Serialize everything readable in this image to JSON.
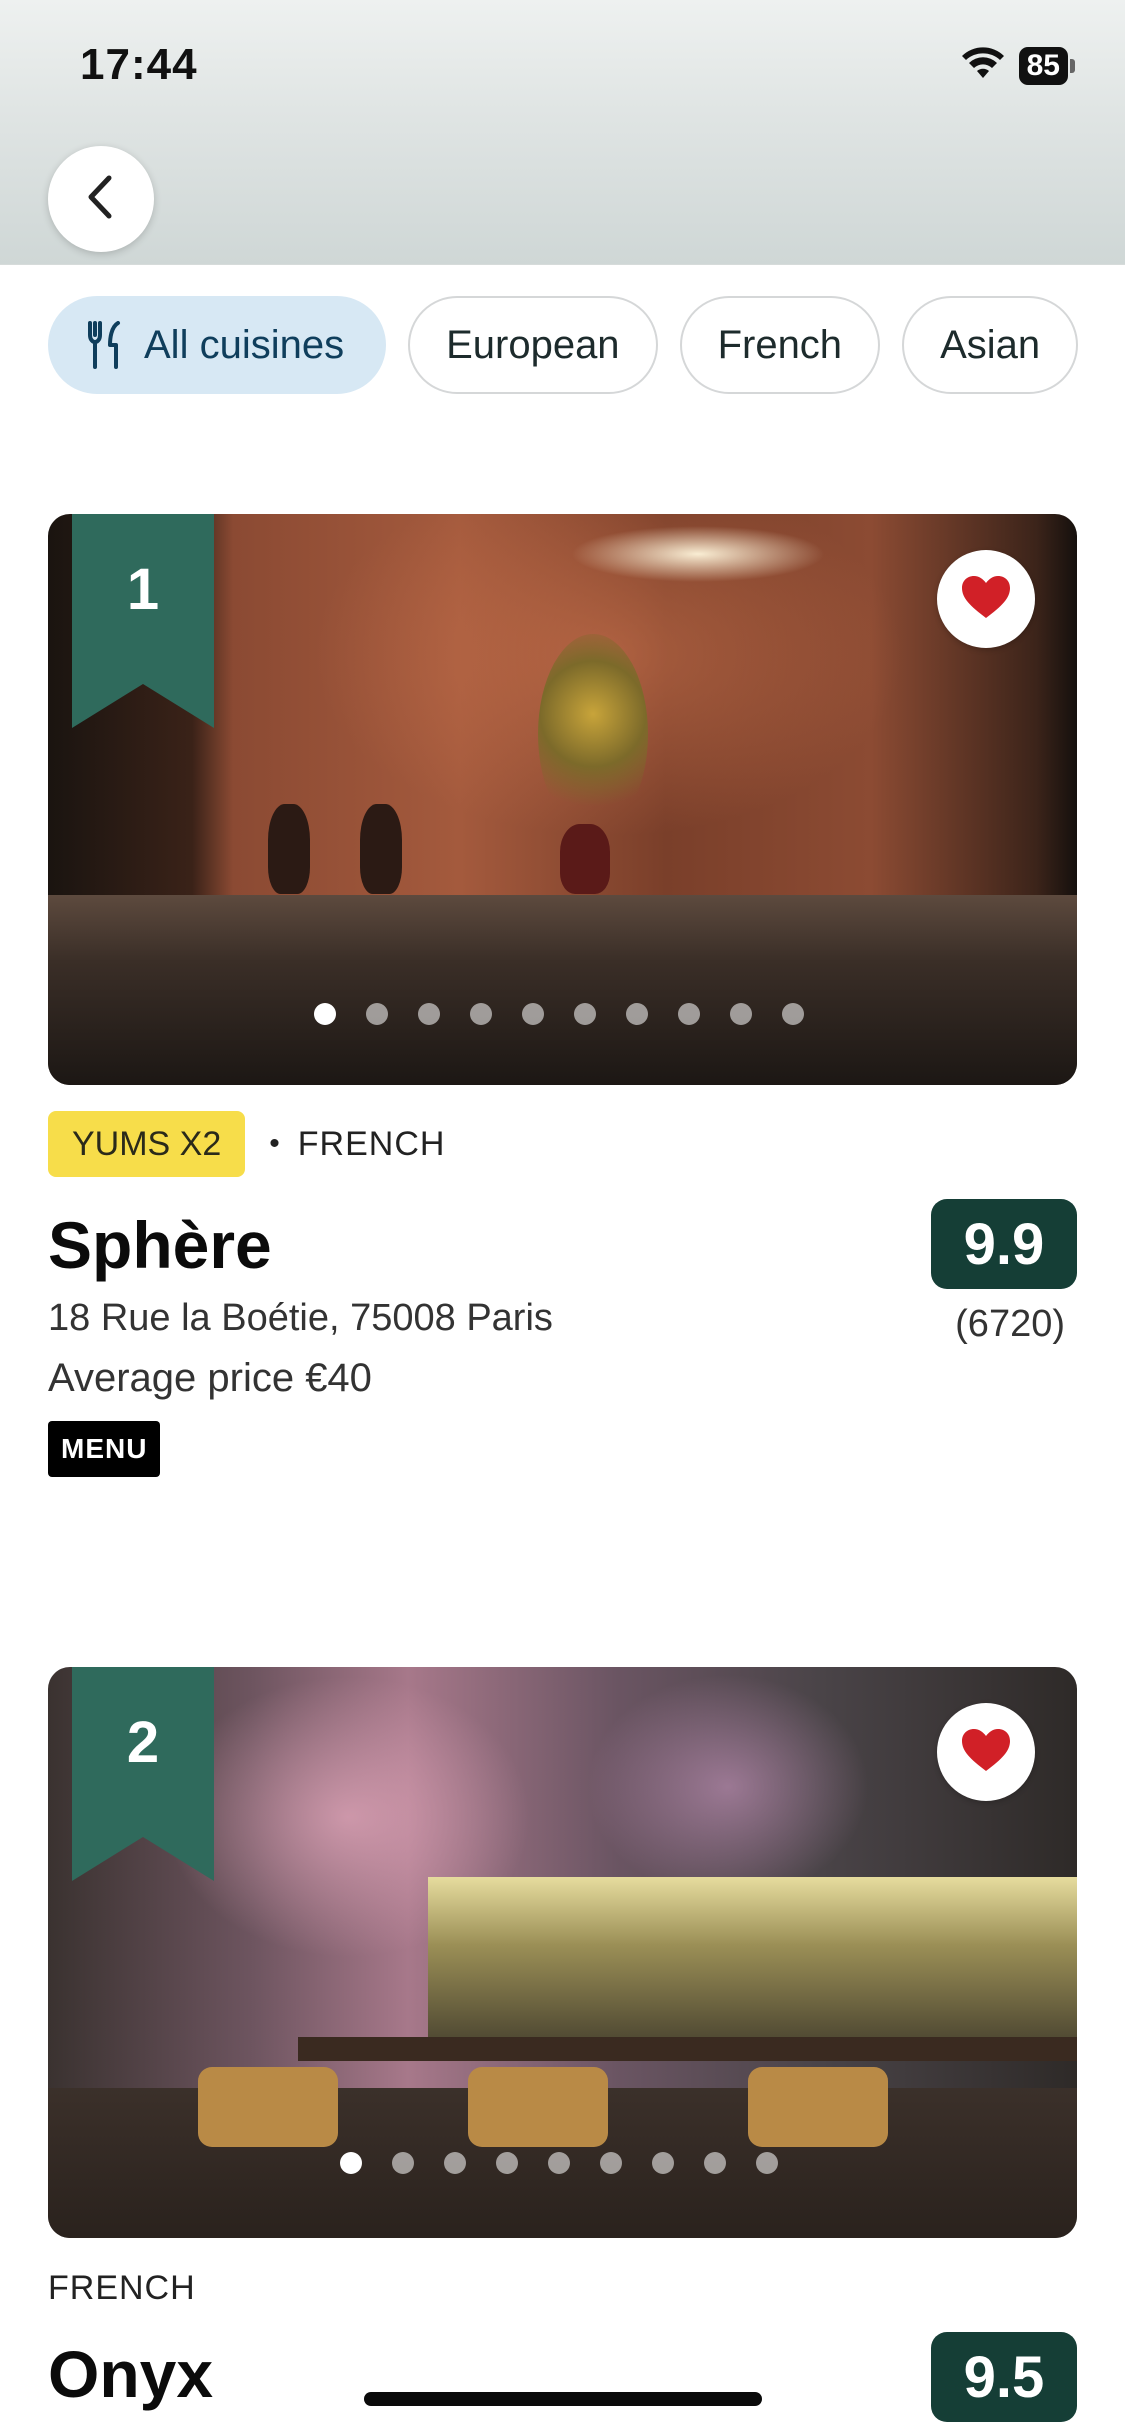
{
  "status_bar": {
    "time": "17:44",
    "battery": "85"
  },
  "filters": [
    {
      "label": "All cuisines",
      "active": true,
      "icon": "cutlery-icon"
    },
    {
      "label": "European",
      "active": false
    },
    {
      "label": "French",
      "active": false
    },
    {
      "label": "Asian",
      "active": false
    }
  ],
  "restaurants": [
    {
      "rank": "1",
      "badge": "YUMS X2",
      "cuisine": "FRENCH",
      "name": "Sphère",
      "address": "18 Rue la Boétie, 75008 Paris",
      "price": "Average price €40",
      "menu_label": "MENU",
      "score": "9.9",
      "review_count": "(6720)",
      "photo_count": 10,
      "active_photo": 1
    },
    {
      "rank": "2",
      "cuisine": "FRENCH",
      "name": "Onyx",
      "score": "9.5",
      "photo_count": 9,
      "active_photo": 1
    }
  ],
  "colors": {
    "ribbon": "#2f6a5c",
    "score_bg": "#153e36",
    "yums_badge": "#f7dd4a",
    "active_chip": "#d7e8f4",
    "heart": "#d12027"
  }
}
